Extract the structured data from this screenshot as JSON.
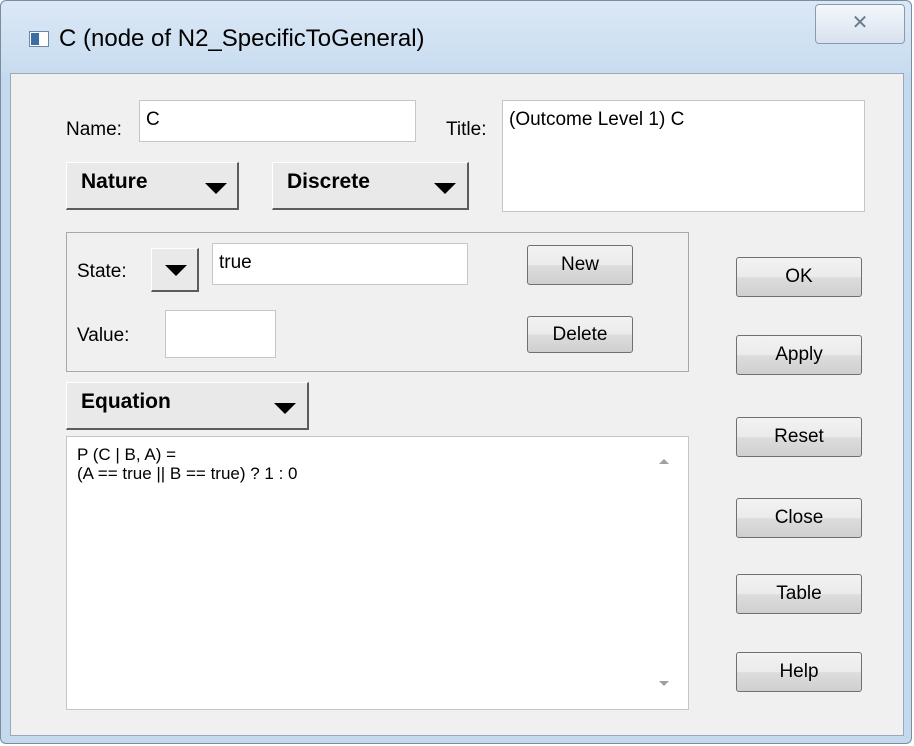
{
  "window": {
    "title": "C (node of N2_SpecificToGeneral)",
    "close_symbol": "✕",
    "icon": "app-icon"
  },
  "form": {
    "name_label": "Name:",
    "name_value": "C",
    "title_label": "Title:",
    "title_value": "(Outcome Level 1) C",
    "nature_dropdown": "Nature",
    "discrete_dropdown": "Discrete",
    "state_label": "State:",
    "state_value": "true",
    "value_label": "Value:",
    "value_value": "",
    "equation_dropdown": "Equation",
    "equation_lines": [
      "P (C | B, A) =",
      "(A == true || B == true) ? 1 : 0"
    ]
  },
  "buttons": {
    "new": "New",
    "delete": "Delete",
    "ok": "OK",
    "apply": "Apply",
    "reset": "Reset",
    "close": "Close",
    "table": "Table",
    "help": "Help"
  },
  "icons": {
    "dropdown_arrow": "chevron-down-icon",
    "scroll_up": "scroll-up-icon",
    "scroll_down": "scroll-down-icon"
  }
}
